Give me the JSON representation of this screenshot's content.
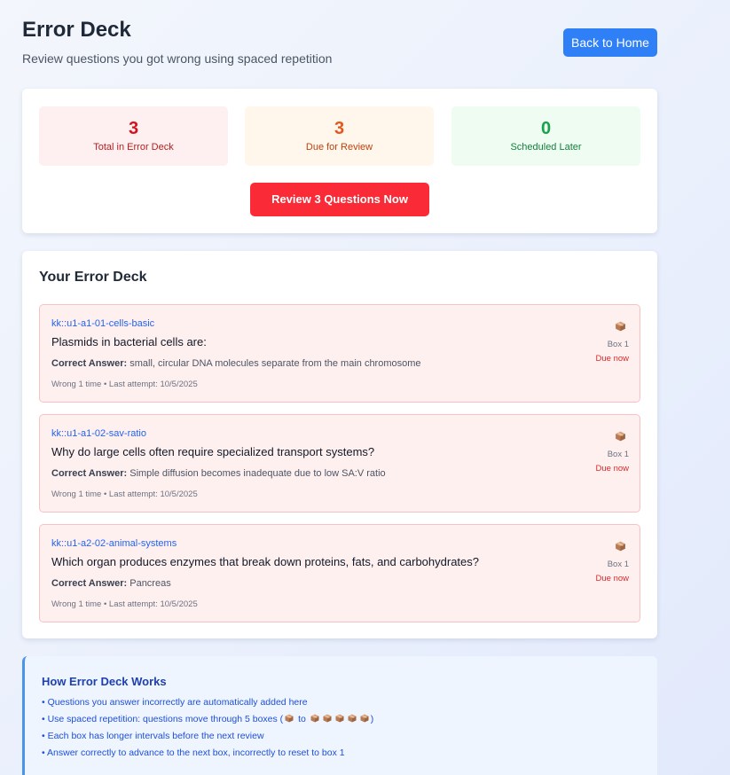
{
  "header": {
    "title": "Error Deck",
    "subtitle": "Review questions you got wrong using spaced repetition",
    "back_button": "Back to Home"
  },
  "stats": {
    "total": {
      "value": "3",
      "label": "Total in Error Deck"
    },
    "due": {
      "value": "3",
      "label": "Due for Review"
    },
    "later": {
      "value": "0",
      "label": "Scheduled Later"
    },
    "review_button": "Review 3 Questions Now"
  },
  "deck": {
    "title": "Your Error Deck",
    "answer_label": "Correct Answer:",
    "items": [
      {
        "tag": "kk::u1-a1-01-cells-basic",
        "question": "Plasmids in bacterial cells are:",
        "answer": "small, circular DNA molecules separate from the main chromosome",
        "meta": "Wrong 1 time • Last attempt: 10/5/2025",
        "box_icon": "package-icon",
        "box": "Box 1",
        "due": "Due now"
      },
      {
        "tag": "kk::u1-a1-02-sav-ratio",
        "question": "Why do large cells often require specialized transport systems?",
        "answer": "Simple diffusion becomes inadequate due to low SA:V ratio",
        "meta": "Wrong 1 time • Last attempt: 10/5/2025",
        "box_icon": "package-icon",
        "box": "Box 1",
        "due": "Due now"
      },
      {
        "tag": "kk::u1-a2-02-animal-systems",
        "question": "Which organ produces enzymes that break down proteins, fats, and carbohydrates?",
        "answer": "Pancreas",
        "meta": "Wrong 1 time • Last attempt: 10/5/2025",
        "box_icon": "package-icon",
        "box": "Box 1",
        "due": "Due now"
      }
    ]
  },
  "info": {
    "title": "How Error Deck Works",
    "line1": "• Questions you answer incorrectly are automatically added here",
    "line2_prefix": "• Use spaced repetition: questions move through 5 boxes (",
    "line2_to": " to ",
    "line2_suffix": ")",
    "line3": "• Each box has longer intervals before the next review",
    "line4": "• Answer correctly to advance to the next box, incorrectly to reset to box 1"
  },
  "colors": {
    "primary": "#2f80f6",
    "danger": "#fb2a37",
    "total": "#d4121c",
    "due": "#e4571a",
    "later": "#17a34a"
  }
}
